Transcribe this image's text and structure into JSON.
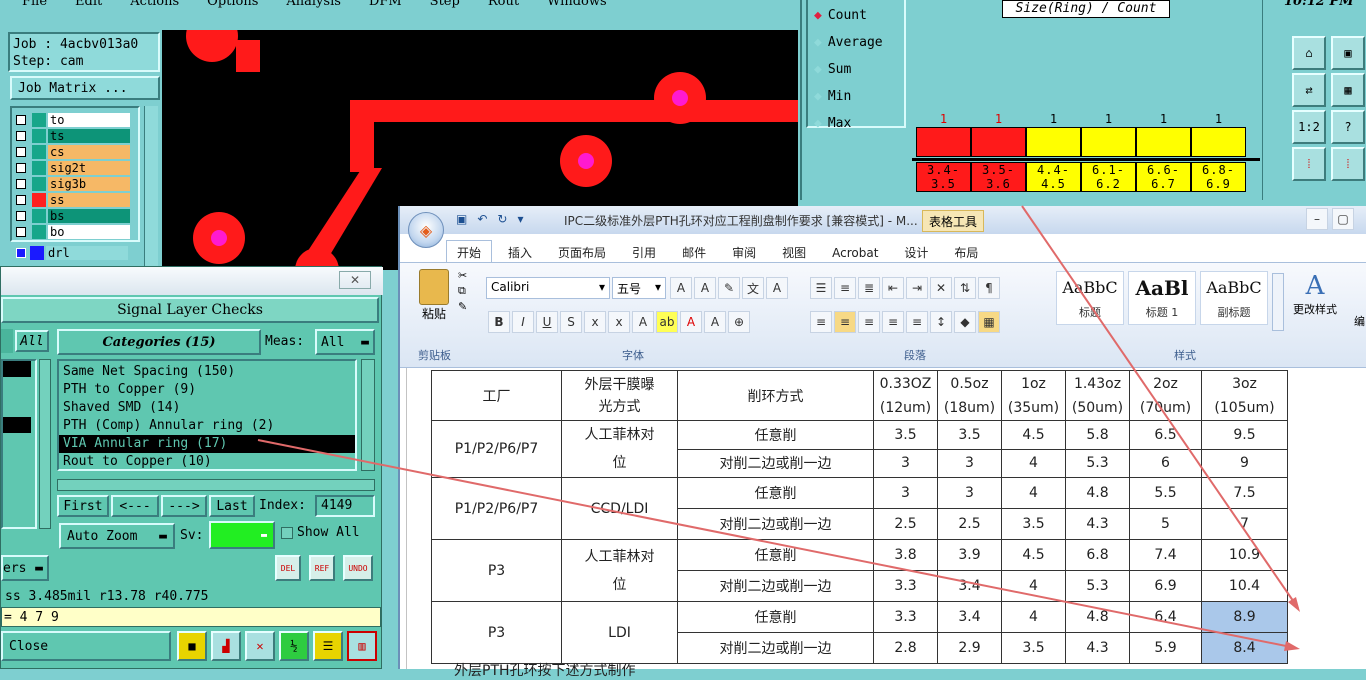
{
  "menu": [
    "File",
    "Edit",
    "Actions",
    "Options",
    "Analysis",
    "DFM",
    "Step",
    "Rout",
    "Windows"
  ],
  "job": {
    "job": "Job : 4acbv013a0",
    "step": "Step: cam",
    "matrix": "Job Matrix ..."
  },
  "layers": [
    {
      "name": "to",
      "color": "#ffffff",
      "mark": "#17a68a"
    },
    {
      "name": "ts",
      "color": "#0d9478",
      "mark": "#17a68a"
    },
    {
      "name": "cs",
      "color": "#f6b866",
      "mark": "#17a68a"
    },
    {
      "name": "sig2t",
      "color": "#f6b866",
      "mark": "#17a68a"
    },
    {
      "name": "sig3b",
      "color": "#f6b866",
      "mark": "#17a68a"
    },
    {
      "name": "ss",
      "color": "#f6b866",
      "mark": "#ff2020"
    },
    {
      "name": "bs",
      "color": "#0d9478",
      "mark": "#17a68a"
    },
    {
      "name": "bo",
      "color": "#ffffff",
      "mark": "#17a68a"
    },
    {
      "name": "drl",
      "color": "#7ecfd0",
      "mark": "#1a1aff"
    }
  ],
  "stats": {
    "items": [
      "Count",
      "Average",
      "Sum",
      "Min",
      "Max"
    ],
    "title": "Size(Ring) / Count",
    "time": "10:12 PM"
  },
  "histogram": {
    "counts": [
      "1",
      "1",
      "1",
      "1",
      "1",
      "1"
    ],
    "labels": [
      [
        "3.4-",
        "3.5"
      ],
      [
        "3.5-",
        "3.6"
      ],
      [
        "4.4-",
        "4.5"
      ],
      [
        "6.1-",
        "6.2"
      ],
      [
        "6.6-",
        "6.7"
      ],
      [
        "6.8-",
        "6.9"
      ]
    ],
    "colors": [
      "#ff1a1a",
      "#ff1a1a",
      "#ffff00",
      "#ffff00",
      "#ffff00",
      "#ffff00"
    ]
  },
  "checks": {
    "window_title": "Signal Layer Checks",
    "all": "All",
    "categories_label": "Categories (15)",
    "meas_label": "Meas:",
    "meas_value": "All",
    "items": [
      "Same Net Spacing (150)",
      "PTH to Copper (9)",
      "Shaved SMD (14)",
      "PTH (Comp) Annular ring (2)",
      "VIA Annular ring (17)",
      "Rout to Copper (10)"
    ],
    "selected_index": 4,
    "nav": [
      "First",
      "<---",
      "--->",
      "Last"
    ],
    "index_label": "Index:",
    "index_value": "4149",
    "auto_zoom": "Auto Zoom",
    "sv_label": "Sv:",
    "show_all": "Show All",
    "ers": "ers",
    "measure": "ss 3.485mil  r13.78  r40.775",
    "eq": "= 4 7 9",
    "close": "Close",
    "icons": [
      "DEL",
      "REF",
      "UNDO"
    ]
  },
  "word": {
    "title": "IPC二级标准外层PTH孔环对应工程削盘制作要求 [兼容模式] - M...",
    "tools": "表格工具",
    "tabs": [
      "开始",
      "插入",
      "页面布局",
      "引用",
      "邮件",
      "审阅",
      "视图",
      "Acrobat",
      "设计",
      "布局"
    ],
    "font_name": "Calibri",
    "font_size": "五号",
    "paste": "粘贴",
    "groups": [
      "剪贴板",
      "字体",
      "段落",
      "样式"
    ],
    "styles": [
      {
        "preview": "AaBbC",
        "name": "标题"
      },
      {
        "preview": "AaBl",
        "name": "标题 1"
      },
      {
        "preview": "AaBbC",
        "name": "副标题"
      }
    ],
    "change_style": "更改样式",
    "edit": "编"
  },
  "table": {
    "header": {
      "col1": "工厂",
      "col2a": "外层干膜曝",
      "col2b": "光方式",
      "col3": "削环方式",
      "cu": [
        [
          "0.33OZ",
          "(12um)"
        ],
        [
          "0.5oz",
          "(18um)"
        ],
        [
          "1oz",
          "(35um)"
        ],
        [
          "1.43oz",
          "(50um)"
        ],
        [
          "2oz",
          "(70um)"
        ],
        [
          "3oz",
          "(105um)"
        ]
      ]
    },
    "groups": [
      {
        "factory": "P1/P2/P6/P7",
        "exp": [
          "人工菲林对",
          "位"
        ],
        "rows": [
          {
            "method": "任意削",
            "v": [
              "3.5",
              "3.5",
              "4.5",
              "5.8",
              "6.5",
              "9.5"
            ]
          },
          {
            "method": "对削二边或削一边",
            "v": [
              "3",
              "3",
              "4",
              "5.3",
              "6",
              "9"
            ]
          }
        ]
      },
      {
        "factory": "P1/P2/P6/P7",
        "exp": [
          "CCD/LDI"
        ],
        "rows": [
          {
            "method": "任意削",
            "v": [
              "3",
              "3",
              "4",
              "4.8",
              "5.5",
              "7.5"
            ]
          },
          {
            "method": "对削二边或削一边",
            "v": [
              "2.5",
              "2.5",
              "3.5",
              "4.3",
              "5",
              "7"
            ]
          }
        ]
      },
      {
        "factory": "P3",
        "exp": [
          "人工菲林对",
          "位"
        ],
        "rows": [
          {
            "method": "任意削",
            "v": [
              "3.8",
              "3.9",
              "4.5",
              "6.8",
              "7.4",
              "10.9"
            ]
          },
          {
            "method": "对削二边或削一边",
            "v": [
              "3.3",
              "3.4",
              "4",
              "5.3",
              "6.9",
              "10.4"
            ]
          }
        ]
      },
      {
        "factory": "P3",
        "exp": [
          "LDI"
        ],
        "rows": [
          {
            "method": "任意削",
            "v": [
              "3.3",
              "3.4",
              "4",
              "4.8",
              "6.4",
              "8.9"
            ]
          },
          {
            "method": "对削二边或削一边",
            "v": [
              "2.8",
              "2.9",
              "3.5",
              "4.3",
              "5.9",
              "8.4"
            ]
          }
        ]
      }
    ],
    "footer": "外层PTH孔环按下述方式制作"
  }
}
